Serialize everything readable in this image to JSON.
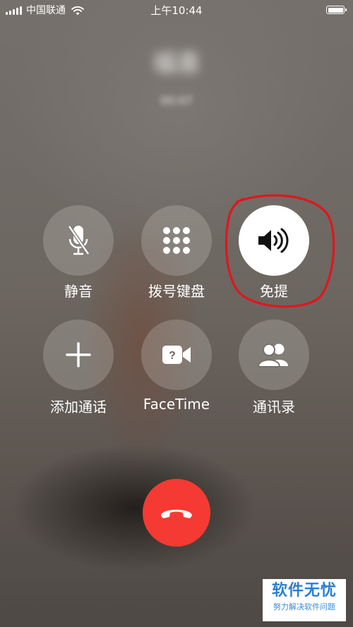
{
  "status_bar": {
    "carrier": "中国联通",
    "time": "上午10:44",
    "battery_level": 1.0
  },
  "caller": {
    "name": "福喜",
    "status": "00:07"
  },
  "controls": [
    {
      "key": "mute",
      "label": "静音",
      "icon": "mic-off-icon"
    },
    {
      "key": "keypad",
      "label": "拨号键盘",
      "icon": "keypad-icon"
    },
    {
      "key": "speaker",
      "label": "免提",
      "icon": "speaker-icon",
      "active": true
    },
    {
      "key": "add_call",
      "label": "添加通话",
      "icon": "plus-icon"
    },
    {
      "key": "facetime",
      "label": "FaceTime",
      "icon": "facetime-icon"
    },
    {
      "key": "contacts",
      "label": "通讯录",
      "icon": "contacts-icon"
    }
  ],
  "end_call": {
    "icon": "phone-hangup-icon",
    "color": "#f43a32"
  },
  "annotation": {
    "color": "#e0161e"
  },
  "watermark": {
    "title": "软件无忧",
    "subtitle": "努力解决软件问题"
  }
}
